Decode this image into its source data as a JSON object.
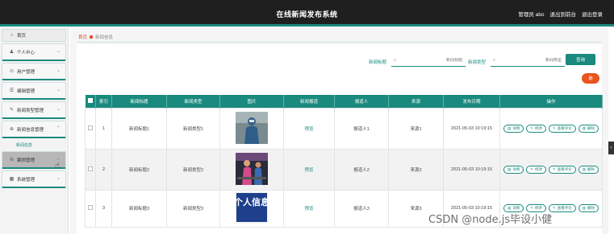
{
  "header": {
    "title": "在线新闻发布系统",
    "admin_label": "管理员 abo",
    "back_label": "退出到前台",
    "logout_label": "退出登录"
  },
  "sidebar": {
    "items": [
      {
        "label": "首页",
        "icon": "home-icon",
        "chevron": ""
      },
      {
        "label": "个人中心",
        "icon": "user-icon",
        "chevron": "⌄"
      },
      {
        "label": "用户管理",
        "icon": "circle-icon",
        "chevron": "⌄"
      },
      {
        "label": "编辑管理",
        "icon": "list-icon",
        "chevron": "⌄"
      },
      {
        "label": "新闻类型管理",
        "icon": "tag-icon",
        "chevron": "⌄"
      },
      {
        "label": "新闻信息管理",
        "icon": "info-icon",
        "chevron": "⌃"
      },
      {
        "label": "新闻信息",
        "icon": "",
        "chevron": ""
      },
      {
        "label": "案例管理",
        "icon": "folder-icon",
        "chevron": "⌄"
      },
      {
        "label": "系统管理",
        "icon": "grid-icon",
        "chevron": "⌄"
      }
    ]
  },
  "breadcrumb": {
    "home": "首页",
    "current": "新闻信息"
  },
  "search": {
    "title_label": "新闻标题",
    "title_placeholder": "新闻标题",
    "type_label": "新闻类型",
    "type_placeholder": "新闻类型",
    "button": "查询"
  },
  "delete_button": "删",
  "table": {
    "headers": [
      "",
      "索引",
      "新闻标题",
      "新闻类型",
      "图片",
      "新闻报道",
      "报道人",
      "来源",
      "发布日期",
      "操作"
    ],
    "rows": [
      {
        "index": "1",
        "title": "新闻标题1",
        "type": "新闻类型1",
        "report": "预览",
        "reporter": "报道人1",
        "source": "来源1",
        "date": "2021-05-03 10:19:15"
      },
      {
        "index": "2",
        "title": "新闻标题2",
        "type": "新闻类型2",
        "report": "预览",
        "reporter": "报道人2",
        "source": "来源2",
        "date": "2021-05-03 10:19:15"
      },
      {
        "index": "3",
        "title": "新闻标题3",
        "type": "新闻类型3",
        "report": "预览",
        "reporter": "报道人3",
        "source": "来源3",
        "date": "2021-05-03 10:19:15"
      }
    ],
    "ops": {
      "detail": "详情",
      "edit": "修改",
      "comments": "查看评论",
      "delete": "删除"
    }
  },
  "thumb3_text": "个人信息",
  "watermark": "CSDN @node.js毕设小健",
  "colors": {
    "accent": "#1a8a7e",
    "danger": "#e9531c",
    "header_bg": "#1f1f1f"
  }
}
